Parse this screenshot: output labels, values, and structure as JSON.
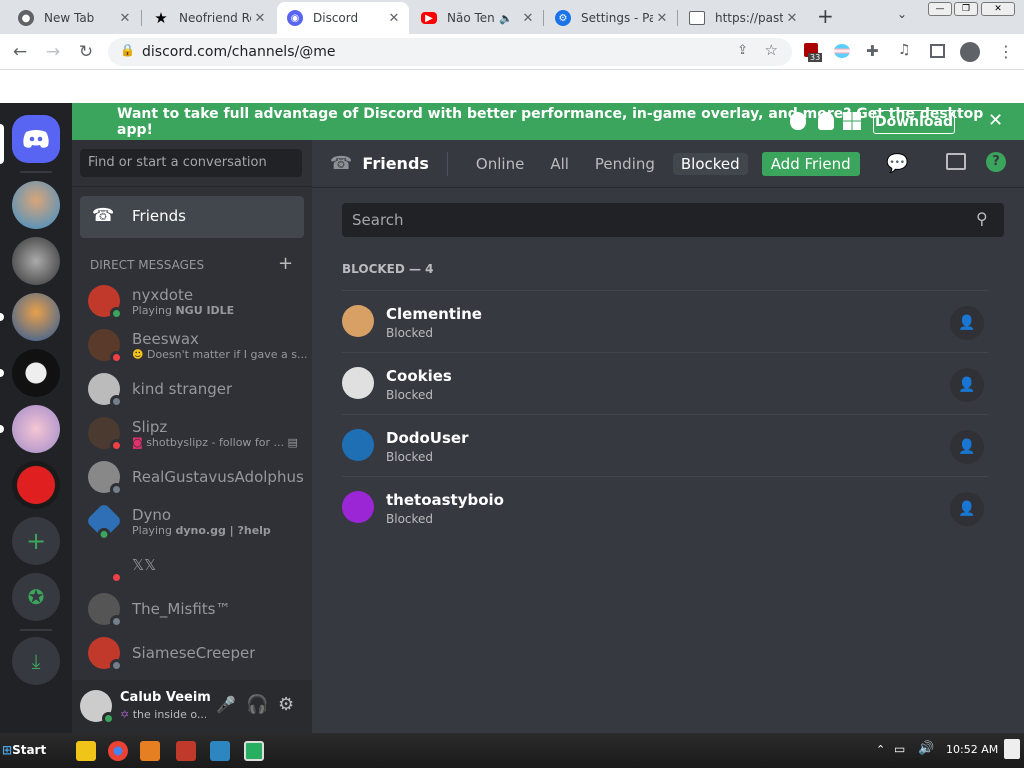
{
  "browser": {
    "tabs": [
      {
        "label": "New Tab",
        "icon": "chrome-icon"
      },
      {
        "label": "Neofriend Re",
        "icon": "star-icon"
      },
      {
        "label": "Discord",
        "icon": "discord-icon"
      },
      {
        "label": "Não Ten",
        "icon": "youtube-icon"
      },
      {
        "label": "Settings - Pa",
        "icon": "gear-icon"
      },
      {
        "label": "https://paste",
        "icon": "page-icon"
      }
    ],
    "new_tab_symbol": "+",
    "url": "discord.com/channels/@me",
    "extension_badge": "33"
  },
  "banner": {
    "text": "Want to take full advantage of Discord with better performance, in-game overlay, and more? Get the desktop app!",
    "download_label": "Download"
  },
  "sidebar": {
    "search_placeholder": "Find or start a conversation",
    "friends_label": "Friends",
    "direct_messages_label": "DIRECT MESSAGES",
    "dms": [
      {
        "name": "nyxdote",
        "sub_prefix": "Playing ",
        "sub_bold": "NGU IDLE",
        "status": "online",
        "color": "#c0392b"
      },
      {
        "name": "Beeswax",
        "sub_prefix": "Doesn't matter if I gave a s...",
        "sub_bold": "",
        "status": "dnd",
        "color": "#5a3a2a"
      },
      {
        "name": "kind stranger",
        "sub_prefix": "",
        "sub_bold": "",
        "status": "offline",
        "color": "#8e9297"
      },
      {
        "name": "Slipz",
        "sub_prefix": "shotbyslipz - follow for ...",
        "sub_bold": "",
        "status": "dnd",
        "color": "#4a3a30"
      },
      {
        "name": "RealGustavusAdolphus",
        "sub_prefix": "",
        "sub_bold": "",
        "status": "offline",
        "color": "#777"
      },
      {
        "name": "Dyno",
        "sub_prefix": "Playing ",
        "sub_bold": "dyno.gg | ?help",
        "status": "online",
        "color": "#2f6fb5"
      },
      {
        "name": "𝕏𝕏",
        "sub_prefix": "",
        "sub_bold": "",
        "status": "dnd",
        "color": "#2f3136"
      },
      {
        "name": "The_Misfits™",
        "sub_prefix": "",
        "sub_bold": "",
        "status": "offline",
        "color": "#555"
      },
      {
        "name": "SiameseCreeper",
        "sub_prefix": "",
        "sub_bold": "",
        "status": "offline",
        "color": "#c0392b"
      }
    ],
    "user": {
      "name": "Calub Veeim",
      "status": "the inside o..."
    }
  },
  "main": {
    "friends_title": "Friends",
    "tabs": [
      "Online",
      "All",
      "Pending",
      "Blocked"
    ],
    "add_friend_label": "Add Friend",
    "search_placeholder": "Search",
    "section_header": "BLOCKED — 4",
    "blocked": [
      {
        "name": "Clementine",
        "status": "Blocked",
        "color": "#d9a066"
      },
      {
        "name": "Cookies",
        "status": "Blocked",
        "color": "#e0e0e0"
      },
      {
        "name": "DodoUser",
        "status": "Blocked",
        "color": "#1f6fb5"
      },
      {
        "name": "thetoastyboio",
        "status": "Blocked",
        "color": "#9b26d6"
      }
    ]
  },
  "taskbar": {
    "start_label": "Start",
    "clock": "10:52 AM"
  },
  "colors": {
    "discord_blurple": "#5865f2",
    "banner_green": "#3ba55d",
    "online": "#3ba55d",
    "dnd": "#ed4245",
    "offline": "#747f8d"
  }
}
